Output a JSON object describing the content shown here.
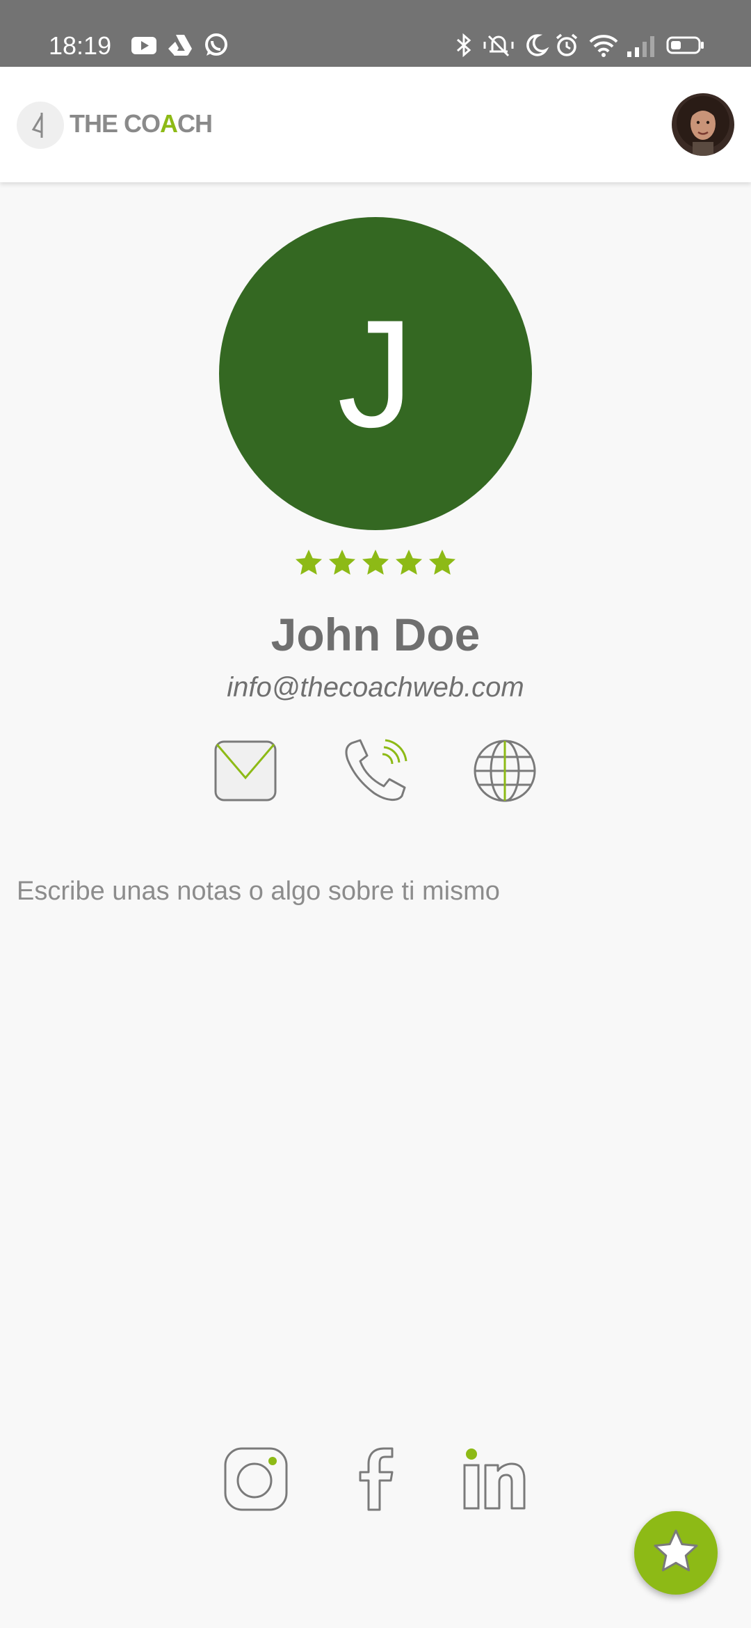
{
  "status_bar": {
    "time": "18:19",
    "left_icons": [
      "youtube-icon",
      "drive-icon",
      "whatsapp-icon"
    ],
    "right_icons": [
      "bluetooth-icon",
      "vibrate-icon",
      "moon-icon",
      "alarm-icon",
      "wifi-icon",
      "signal-icon",
      "battery-icon"
    ]
  },
  "header": {
    "logo_text_prefix": "THE CO",
    "logo_text_accent": "A",
    "logo_text_suffix": "CH",
    "accent_color": "#8dba16"
  },
  "profile": {
    "initial": "J",
    "avatar_color": "#346822",
    "rating": 5,
    "name": "John Doe",
    "email": "info@thecoachweb.com"
  },
  "contact_actions": [
    "mail-icon",
    "phone-icon",
    "globe-icon"
  ],
  "notes": {
    "placeholder": "Escribe unas notas o algo sobre ti mismo"
  },
  "social_links": [
    "instagram-icon",
    "facebook-icon",
    "linkedin-icon"
  ],
  "fab": {
    "icon": "star-icon",
    "color": "#8dba16"
  }
}
